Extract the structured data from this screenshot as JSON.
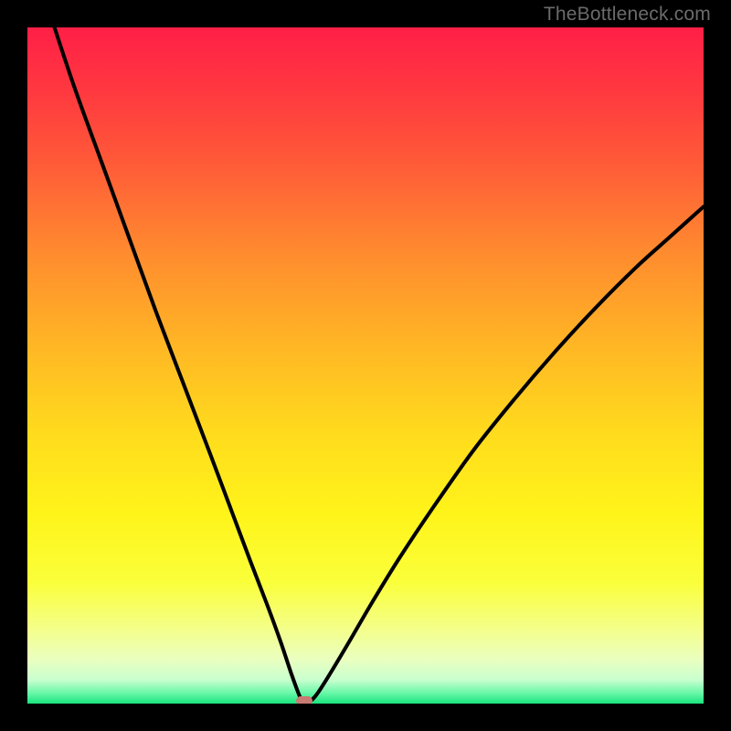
{
  "watermark": {
    "text": "TheBottleneck.com"
  },
  "colors": {
    "frame": "#000000",
    "marker": "#c97a72",
    "gradient_stops": [
      {
        "offset": 0.0,
        "color": "#ff1f47"
      },
      {
        "offset": 0.1,
        "color": "#ff3a3f"
      },
      {
        "offset": 0.2,
        "color": "#ff5a38"
      },
      {
        "offset": 0.33,
        "color": "#ff8a2f"
      },
      {
        "offset": 0.48,
        "color": "#ffb924"
      },
      {
        "offset": 0.6,
        "color": "#ffdb1d"
      },
      {
        "offset": 0.72,
        "color": "#fff41a"
      },
      {
        "offset": 0.82,
        "color": "#faff3a"
      },
      {
        "offset": 0.89,
        "color": "#f4ff8a"
      },
      {
        "offset": 0.935,
        "color": "#eaffc0"
      },
      {
        "offset": 0.965,
        "color": "#c8ffcf"
      },
      {
        "offset": 0.985,
        "color": "#66f7a6"
      },
      {
        "offset": 1.0,
        "color": "#19e37e"
      }
    ]
  },
  "chart_data": {
    "type": "line",
    "title": "",
    "xlabel": "",
    "ylabel": "",
    "x_range": [
      0,
      100
    ],
    "y_range": [
      0,
      100
    ],
    "minimum": {
      "x": 41,
      "y": 0
    },
    "series": [
      {
        "name": "bottleneck-curve",
        "points": [
          {
            "x": 4.0,
            "y": 100.0
          },
          {
            "x": 7.0,
            "y": 91.0
          },
          {
            "x": 11.0,
            "y": 80.0
          },
          {
            "x": 15.0,
            "y": 69.0
          },
          {
            "x": 19.0,
            "y": 58.0
          },
          {
            "x": 23.0,
            "y": 47.5
          },
          {
            "x": 27.0,
            "y": 37.0
          },
          {
            "x": 30.0,
            "y": 29.0
          },
          {
            "x": 33.0,
            "y": 21.0
          },
          {
            "x": 35.5,
            "y": 14.5
          },
          {
            "x": 37.5,
            "y": 9.0
          },
          {
            "x": 39.0,
            "y": 4.5
          },
          {
            "x": 40.3,
            "y": 1.0
          },
          {
            "x": 41.0,
            "y": 0.0
          },
          {
            "x": 42.5,
            "y": 1.0
          },
          {
            "x": 44.5,
            "y": 4.0
          },
          {
            "x": 47.5,
            "y": 9.0
          },
          {
            "x": 51.0,
            "y": 15.0
          },
          {
            "x": 55.0,
            "y": 21.5
          },
          {
            "x": 60.0,
            "y": 29.0
          },
          {
            "x": 66.0,
            "y": 37.5
          },
          {
            "x": 72.0,
            "y": 45.0
          },
          {
            "x": 78.0,
            "y": 52.0
          },
          {
            "x": 84.0,
            "y": 58.5
          },
          {
            "x": 90.0,
            "y": 64.5
          },
          {
            "x": 95.0,
            "y": 69.0
          },
          {
            "x": 100.0,
            "y": 73.5
          }
        ]
      }
    ]
  }
}
